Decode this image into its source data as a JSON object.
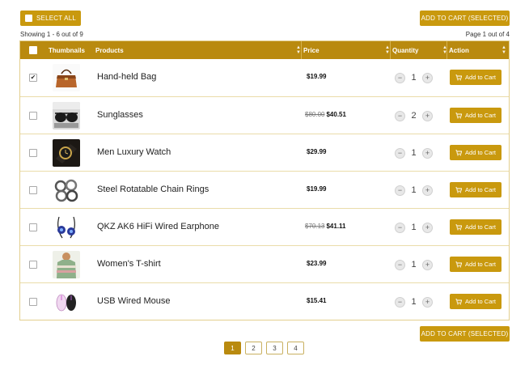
{
  "toolbar": {
    "select_all_label": "SELECT ALL",
    "add_to_cart_selected_label": "ADD TO CART (SELECTED)",
    "showing_text": "Showing 1 - 6 out of 9",
    "page_text": "Page 1 out of 4"
  },
  "table": {
    "headers": [
      "Thumbnails",
      "Products",
      "Price",
      "Quantity",
      "Action"
    ],
    "add_label": "Add to Cart",
    "rows": [
      {
        "name": "Hand-held Bag",
        "old_price": "",
        "price": "$19.99",
        "qty": "1",
        "checked": "✔",
        "thumb": "handbag"
      },
      {
        "name": "Sunglasses",
        "old_price": "$80.00",
        "price": "$40.51",
        "qty": "2",
        "checked": "",
        "thumb": "sunglasses"
      },
      {
        "name": "Men Luxury Watch",
        "old_price": "",
        "price": "$29.99",
        "qty": "1",
        "checked": "",
        "thumb": "watch"
      },
      {
        "name": "Steel Rotatable Chain Rings",
        "old_price": "",
        "price": "$19.99",
        "qty": "1",
        "checked": "",
        "thumb": "rings"
      },
      {
        "name": "QKZ AK6 HiFi Wired Earphone",
        "old_price": "$70.13",
        "price": "$41.11",
        "qty": "1",
        "checked": "",
        "thumb": "earphone"
      },
      {
        "name": "Women's T-shirt",
        "old_price": "",
        "price": "$23.99",
        "qty": "1",
        "checked": "",
        "thumb": "tshirt"
      },
      {
        "name": "USB Wired Mouse",
        "old_price": "",
        "price": "$15.41",
        "qty": "1",
        "checked": "",
        "thumb": "mouse"
      }
    ]
  },
  "pagination": {
    "pages": [
      "1",
      "2",
      "3",
      "4"
    ],
    "current": "1"
  },
  "colors": {
    "accent": "#c9990e",
    "header": "#b98a0f"
  }
}
